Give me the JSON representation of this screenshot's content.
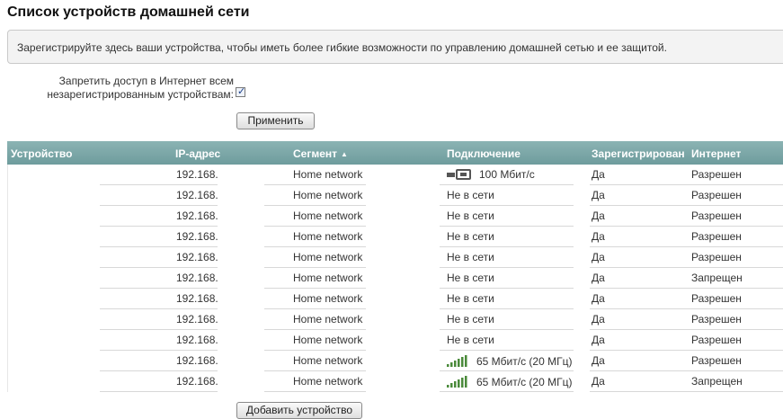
{
  "page": {
    "title": "Список устройств домашней сети",
    "info": "Зарегистрируйте здесь ваши устройства, чтобы иметь более гибкие возможности по управлению домашней сетью и ее защитой.",
    "deny_label_line1": "Запретить доступ в Интернет всем",
    "deny_label_line2": "незарегистрированным устройствам:",
    "deny_checked": true,
    "apply_label": "Применить",
    "add_device_label": "Добавить устройство"
  },
  "table": {
    "columns": {
      "device": "Устройство",
      "ip": "IP-адрес",
      "segment": "Сегмент",
      "connection": "Подключение",
      "registered": "Зарегистрирован",
      "internet": "Интернет"
    },
    "sort_indicator": "▲",
    "rows": [
      {
        "ip": "192.168.",
        "segment": "Home network",
        "connection": "100 Мбит/с",
        "conn_icon": "ethernet-icon",
        "registered": "Да",
        "internet": "Разрешен"
      },
      {
        "ip": "192.168.",
        "segment": "Home network",
        "connection": "Не в сети",
        "conn_icon": "",
        "registered": "Да",
        "internet": "Разрешен"
      },
      {
        "ip": "192.168.",
        "segment": "Home network",
        "connection": "Не в сети",
        "conn_icon": "",
        "registered": "Да",
        "internet": "Разрешен"
      },
      {
        "ip": "192.168.",
        "segment": "Home network",
        "connection": "Не в сети",
        "conn_icon": "",
        "registered": "Да",
        "internet": "Разрешен"
      },
      {
        "ip": "192.168.",
        "segment": "Home network",
        "connection": "Не в сети",
        "conn_icon": "",
        "registered": "Да",
        "internet": "Разрешен"
      },
      {
        "ip": "192.168.",
        "segment": "Home network",
        "connection": "Не в сети",
        "conn_icon": "",
        "registered": "Да",
        "internet": "Запрещен"
      },
      {
        "ip": "192.168.",
        "segment": "Home network",
        "connection": "Не в сети",
        "conn_icon": "",
        "registered": "Да",
        "internet": "Разрешен"
      },
      {
        "ip": "192.168.",
        "segment": "Home network",
        "connection": "Не в сети",
        "conn_icon": "",
        "registered": "Да",
        "internet": "Разрешен"
      },
      {
        "ip": "192.168.",
        "segment": "Home network",
        "connection": "Не в сети",
        "conn_icon": "",
        "registered": "Да",
        "internet": "Разрешен"
      },
      {
        "ip": "192.168.",
        "segment": "Home network",
        "connection": "65 Мбит/с (20 МГц)",
        "conn_icon": "wifi-signal-icon",
        "registered": "Да",
        "internet": "Разрешен"
      },
      {
        "ip": "192.168.",
        "segment": "Home network",
        "connection": "65 Мбит/с (20 МГц)",
        "conn_icon": "wifi-signal-icon",
        "registered": "Да",
        "internet": "Запрещен"
      }
    ]
  },
  "colors": {
    "header_bg": "#7aa6a7",
    "info_bg": "#f3f3f3",
    "icon_ethernet": "#555555",
    "icon_wifi": "#4a8a3a"
  }
}
